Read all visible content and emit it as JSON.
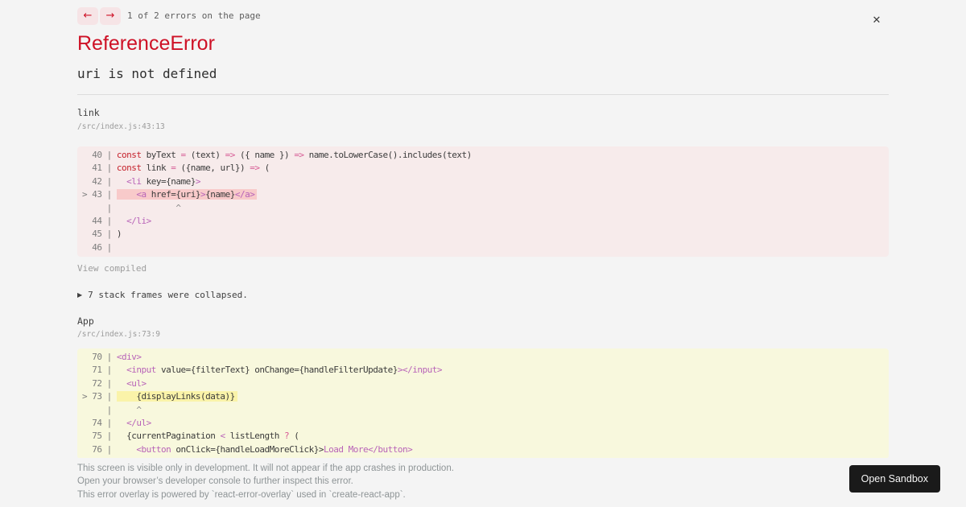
{
  "overlay": {
    "counter": "1 of 2 errors on the page",
    "prev_icon": "←",
    "next_icon": "→",
    "close_icon": "✕",
    "error_type": "ReferenceError",
    "error_message": "uri is not defined"
  },
  "frames": [
    {
      "function": "link",
      "location": "/src/index.js:43:13",
      "view_label": "View compiled",
      "lines": [
        {
          "gutter": "  40 | ",
          "tokens": [
            {
              "t": "const",
              "c": "kw"
            },
            {
              "t": " byText ",
              "c": "pl"
            },
            {
              "t": "=",
              "c": "op"
            },
            {
              "t": " (text) ",
              "c": "pl"
            },
            {
              "t": "=>",
              "c": "op"
            },
            {
              "t": " ({ name }) ",
              "c": "pl"
            },
            {
              "t": "=>",
              "c": "op"
            },
            {
              "t": " name.toLowerCase().includes(text)",
              "c": "pl"
            }
          ]
        },
        {
          "gutter": "  41 | ",
          "tokens": [
            {
              "t": "const",
              "c": "kw"
            },
            {
              "t": " link ",
              "c": "pl"
            },
            {
              "t": "=",
              "c": "op"
            },
            {
              "t": " ({name, url}) ",
              "c": "pl"
            },
            {
              "t": "=>",
              "c": "op"
            },
            {
              "t": " (",
              "c": "pl"
            }
          ]
        },
        {
          "gutter": "  42 | ",
          "tokens": [
            {
              "t": "  ",
              "c": "pl"
            },
            {
              "t": "<li",
              "c": "tag"
            },
            {
              "t": " key={name}",
              "c": "pl"
            },
            {
              "t": ">",
              "c": "tag"
            }
          ]
        },
        {
          "gutter": "> 43 | ",
          "highlight": true,
          "tokens": [
            {
              "t": "    ",
              "c": "pl"
            },
            {
              "t": "<a",
              "c": "tag"
            },
            {
              "t": " href={uri}",
              "c": "pl"
            },
            {
              "t": ">",
              "c": "tag"
            },
            {
              "t": "{name}",
              "c": "pl"
            },
            {
              "t": "</a>",
              "c": "tag"
            }
          ]
        },
        {
          "gutter": "     | ",
          "tokens": [
            {
              "t": "            ^",
              "c": "crt"
            }
          ]
        },
        {
          "gutter": "  44 | ",
          "tokens": [
            {
              "t": "  ",
              "c": "pl"
            },
            {
              "t": "</li>",
              "c": "tag"
            }
          ]
        },
        {
          "gutter": "  45 | ",
          "tokens": [
            {
              "t": ")",
              "c": "pl"
            }
          ]
        },
        {
          "gutter": "  46 | ",
          "tokens": []
        }
      ]
    },
    {
      "function": "App",
      "location": "/src/index.js:73:9",
      "lines": [
        {
          "gutter": "  70 | ",
          "tokens": [
            {
              "t": "<div>",
              "c": "tag"
            }
          ]
        },
        {
          "gutter": "  71 | ",
          "tokens": [
            {
              "t": "  ",
              "c": "pl"
            },
            {
              "t": "<input",
              "c": "tag"
            },
            {
              "t": " value={filterText} onChange={handleFilterUpdate}",
              "c": "pl"
            },
            {
              "t": "></input>",
              "c": "tag"
            }
          ]
        },
        {
          "gutter": "  72 | ",
          "tokens": [
            {
              "t": "  ",
              "c": "pl"
            },
            {
              "t": "<ul>",
              "c": "tag"
            }
          ]
        },
        {
          "gutter": "> 73 | ",
          "highlight": true,
          "tokens": [
            {
              "t": "    {displayLinks(data)}",
              "c": "pl"
            }
          ]
        },
        {
          "gutter": "     | ",
          "tokens": [
            {
              "t": "    ^",
              "c": "crt"
            }
          ]
        },
        {
          "gutter": "  74 | ",
          "tokens": [
            {
              "t": "  ",
              "c": "pl"
            },
            {
              "t": "</ul>",
              "c": "tag"
            }
          ]
        },
        {
          "gutter": "  75 | ",
          "tokens": [
            {
              "t": "  {currentPagination ",
              "c": "pl"
            },
            {
              "t": "<",
              "c": "tag"
            },
            {
              "t": " listLength ",
              "c": "pl"
            },
            {
              "t": "?",
              "c": "op"
            },
            {
              "t": " (",
              "c": "pl"
            }
          ]
        },
        {
          "gutter": "  76 | ",
          "tokens": [
            {
              "t": "    ",
              "c": "pl"
            },
            {
              "t": "<button",
              "c": "tag"
            },
            {
              "t": " onClick={handleLoadMoreClick}",
              "c": "pl"
            },
            {
              "t": ">",
              "c": "pl"
            },
            {
              "t": "Load More",
              "c": "tag"
            },
            {
              "t": "</button>",
              "c": "tag"
            }
          ]
        }
      ]
    }
  ],
  "collapsed": {
    "icon": "▶",
    "label": "7 stack frames were collapsed."
  },
  "footer": {
    "lines": [
      "This screen is visible only in development. It will not appear if the app crashes in production.",
      "Open your browser’s developer console to further inspect this error.",
      "This error overlay is powered by `react-error-overlay` used in `create-react-app`."
    ],
    "button_label": "Open Sandbox"
  },
  "colors": {
    "accent_red": "#ce1126",
    "page_bg": "#f4f4f4",
    "frame1_bg": "#f7ebeb",
    "frame1_highlight": "#f8caca",
    "frame2_bg": "#f8f8dd",
    "frame2_highlight": "#faf3a9",
    "keyword": "#c5222c",
    "operator": "#d75a94",
    "tag": "#b863b8",
    "button_bg": "#1a1a1a"
  }
}
